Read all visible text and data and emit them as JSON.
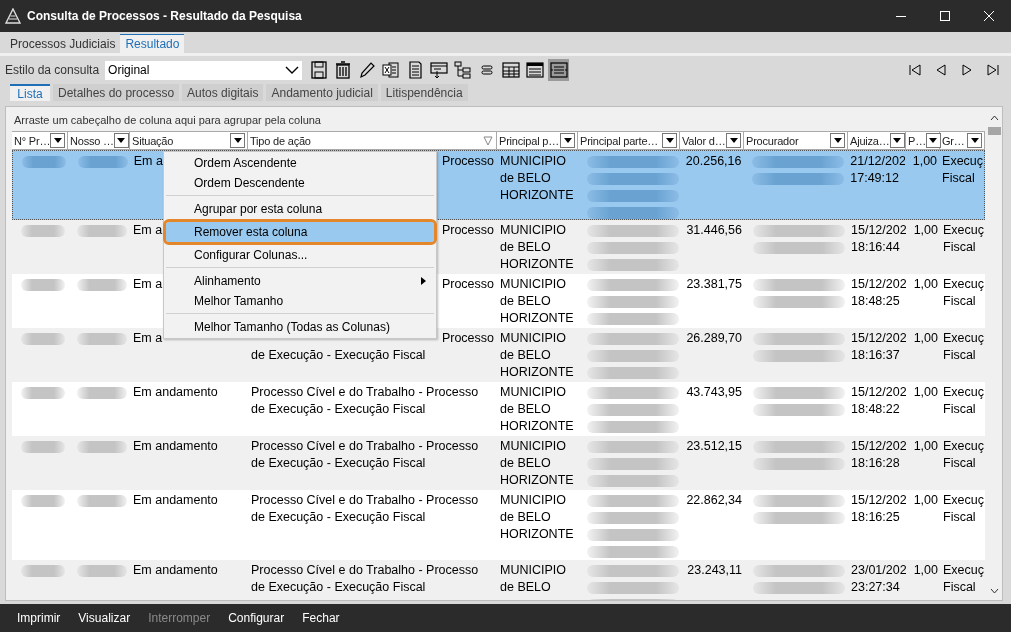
{
  "window": {
    "title": "Consulta de Processos - Resultado da Pesquisa"
  },
  "tabs": [
    {
      "label": "Processos Judiciais",
      "selected": false
    },
    {
      "label": "Resultado",
      "selected": true
    }
  ],
  "query_style": {
    "label": "Estilo da consulta",
    "value": "Original"
  },
  "toolbar": [
    {
      "kind": "save",
      "selected": false
    },
    {
      "kind": "trash",
      "selected": false
    },
    {
      "kind": "pencil",
      "selected": false
    },
    {
      "kind": "excel",
      "selected": false
    },
    {
      "kind": "document",
      "selected": false
    },
    {
      "kind": "export",
      "selected": false
    },
    {
      "kind": "tree",
      "selected": false
    },
    {
      "kind": "link",
      "selected": false
    },
    {
      "kind": "table",
      "selected": false
    },
    {
      "kind": "list",
      "selected": false
    },
    {
      "kind": "layout",
      "selected": true
    }
  ],
  "navigation": [
    {
      "kind": "first"
    },
    {
      "kind": "prev"
    },
    {
      "kind": "next"
    },
    {
      "kind": "last"
    }
  ],
  "subtabs": [
    {
      "label": "Lista",
      "selected": true
    },
    {
      "label": "Detalhes do processo",
      "selected": false
    },
    {
      "label": "Autos digitais",
      "selected": false
    },
    {
      "label": "Andamento judicial",
      "selected": false
    },
    {
      "label": "Litispendência",
      "selected": false
    }
  ],
  "group_hint": "Arraste um cabeçalho de coluna aqui para agrupar pela coluna",
  "table": {
    "columns": [
      {
        "label": "N° Pr…",
        "kind": "dropdown"
      },
      {
        "label": "Nosso …",
        "kind": "dropdown"
      },
      {
        "label": "Situação",
        "kind": "dropdown"
      },
      {
        "label": "Tipo de ação",
        "kind": "filter"
      },
      {
        "label": "Principal p…",
        "kind": "dropdown"
      },
      {
        "label": "Principal parte…",
        "kind": "dropdown"
      },
      {
        "label": "Valor d…",
        "kind": "dropdown"
      },
      {
        "label": "Procurador",
        "kind": "dropdown"
      },
      {
        "label": "Ajuiza…",
        "kind": "dropdown"
      },
      {
        "label": "P…",
        "kind": "dropdown"
      },
      {
        "label": "Gr…",
        "kind": "dropdown"
      }
    ],
    "rows": [
      {
        "selected": true,
        "tall": true,
        "situacao": "Em a",
        "tipo": {
          "covered": true,
          "lines": [
            "Processo"
          ]
        },
        "principal": [
          "MUNICIPIO",
          "de BELO",
          "HORIZONTE"
        ],
        "valor": "20.256,16",
        "ajuizamento": [
          "21/12/202",
          "17:49:12"
        ],
        "p": "1,00",
        "gr": [
          "Execuç",
          "Fiscal"
        ]
      },
      {
        "selected": false,
        "tall": false,
        "situacao": "Em a",
        "tipo": {
          "covered": true,
          "lines": [
            "Processo"
          ]
        },
        "principal": [
          "MUNICIPIO",
          "de BELO",
          "HORIZONTE"
        ],
        "valor": "31.446,56",
        "ajuizamento": [
          "15/12/202",
          "18:16:44"
        ],
        "p": "1,00",
        "gr": [
          "Execuç",
          "Fiscal"
        ]
      },
      {
        "selected": false,
        "tall": false,
        "situacao": "Em a",
        "tipo": {
          "covered": true,
          "lines": [
            "Processo"
          ]
        },
        "principal": [
          "MUNICIPIO",
          "de BELO",
          "HORIZONTE"
        ],
        "valor": "23.381,75",
        "ajuizamento": [
          "15/12/202",
          "18:48:25"
        ],
        "p": "1,00",
        "gr": [
          "Execuç",
          "Fiscal"
        ]
      },
      {
        "selected": false,
        "tall": false,
        "situacao": "Em a",
        "tipo": {
          "covered": true,
          "lines": [
            "Processo",
            "de Execução - Execução Fiscal"
          ]
        },
        "principal": [
          "MUNICIPIO",
          "de BELO",
          "HORIZONTE"
        ],
        "valor": "26.289,70",
        "ajuizamento": [
          "15/12/202",
          "18:16:37"
        ],
        "p": "1,00",
        "gr": [
          "Execuç",
          "Fiscal"
        ]
      },
      {
        "selected": false,
        "tall": false,
        "situacao": "Em andamento",
        "tipo": {
          "covered": false,
          "lines": [
            "Processo Cível e do Trabalho - Processo",
            "de Execução - Execução Fiscal"
          ]
        },
        "principal": [
          "MUNICIPIO",
          "de BELO",
          "HORIZONTE"
        ],
        "valor": "43.743,95",
        "ajuizamento": [
          "15/12/202",
          "18:48:22"
        ],
        "p": "1,00",
        "gr": [
          "Execuç",
          "Fiscal"
        ]
      },
      {
        "selected": false,
        "tall": false,
        "situacao": "Em andamento",
        "tipo": {
          "covered": false,
          "lines": [
            "Processo Cível e do Trabalho - Processo",
            "de Execução - Execução Fiscal"
          ]
        },
        "principal": [
          "MUNICIPIO",
          "de BELO",
          "HORIZONTE"
        ],
        "valor": "23.512,15",
        "ajuizamento": [
          "15/12/202",
          "18:16:28"
        ],
        "p": "1,00",
        "gr": [
          "Execuç",
          "Fiscal"
        ]
      },
      {
        "selected": false,
        "tall": true,
        "situacao": "Em andamento",
        "tipo": {
          "covered": false,
          "lines": [
            "Processo Cível e do Trabalho - Processo",
            "de Execução - Execução Fiscal"
          ]
        },
        "principal": [
          "MUNICIPIO",
          "de BELO",
          "HORIZONTE"
        ],
        "valor": "22.862,34",
        "ajuizamento": [
          "15/12/202",
          "18:16:25"
        ],
        "p": "1,00",
        "gr": [
          "Execuç",
          "Fiscal"
        ]
      },
      {
        "selected": false,
        "tall": false,
        "situacao": "Em andamento",
        "tipo": {
          "covered": false,
          "lines": [
            "Processo Cível e do Trabalho - Processo",
            "de Execução - Execução Fiscal"
          ]
        },
        "principal": [
          "MUNICIPIO",
          "de BELO"
        ],
        "valor": "23.243,11",
        "ajuizamento": [
          "23/01/202",
          "23:27:34"
        ],
        "p": "1,00",
        "gr": [
          "Execuç",
          "Fiscal"
        ]
      }
    ]
  },
  "context_menu": [
    {
      "label": "Ordem Ascendente",
      "highlighted": false,
      "submenu": false,
      "separator_after": false
    },
    {
      "label": "Ordem Descendente",
      "highlighted": false,
      "submenu": false,
      "separator_after": true
    },
    {
      "label": "Agrupar por esta coluna",
      "highlighted": false,
      "submenu": false,
      "separator_after": false
    },
    {
      "label": "Remover esta coluna",
      "highlighted": true,
      "submenu": false,
      "separator_after": false
    },
    {
      "label": "Configurar Colunas...",
      "highlighted": false,
      "submenu": false,
      "separator_after": true
    },
    {
      "label": "Alinhamento",
      "highlighted": false,
      "submenu": true,
      "separator_after": false
    },
    {
      "label": "Melhor Tamanho",
      "highlighted": false,
      "submenu": false,
      "separator_after": true
    },
    {
      "label": "Melhor Tamanho (Todas as Colunas)",
      "highlighted": false,
      "submenu": false,
      "separator_after": false
    }
  ],
  "bottom_buttons": [
    {
      "label": "Imprimir",
      "disabled": false
    },
    {
      "label": "Visualizar",
      "disabled": false
    },
    {
      "label": "Interromper",
      "disabled": true
    },
    {
      "label": "Configurar",
      "disabled": false
    },
    {
      "label": "Fechar",
      "disabled": false
    }
  ]
}
